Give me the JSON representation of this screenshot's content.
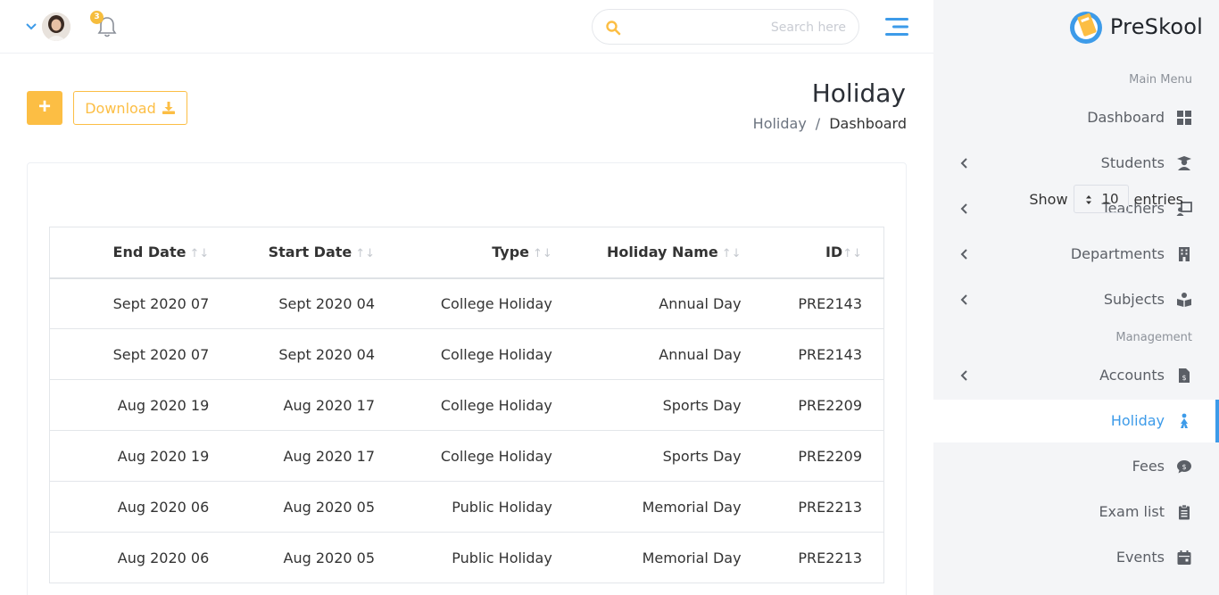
{
  "topbar": {
    "notification_count": "3",
    "search_placeholder": "Search here"
  },
  "brand": {
    "name": "PreSkool"
  },
  "sidebar": {
    "sections": {
      "main": "Main Menu",
      "management": "Management"
    },
    "items": [
      {
        "label": "Dashboard",
        "icon": "dashboard-icon",
        "has_submenu": false
      },
      {
        "label": "Students",
        "icon": "graduate-icon",
        "has_submenu": true
      },
      {
        "label": "Teachers",
        "icon": "chalkboard-teacher-icon",
        "has_submenu": true
      },
      {
        "label": "Departments",
        "icon": "building-icon",
        "has_submenu": true
      },
      {
        "label": "Subjects",
        "icon": "book-reader-icon",
        "has_submenu": true
      },
      {
        "label": "Accounts",
        "icon": "invoice-icon",
        "has_submenu": true
      },
      {
        "label": "Holiday",
        "icon": "holiday-icon",
        "has_submenu": false,
        "active": true
      },
      {
        "label": "Fees",
        "icon": "comment-dollar-icon",
        "has_submenu": false
      },
      {
        "label": "Exam list",
        "icon": "clipboard-list-icon",
        "has_submenu": false
      },
      {
        "label": "Events",
        "icon": "calendar-icon",
        "has_submenu": false
      }
    ]
  },
  "page": {
    "title": "Holiday",
    "breadcrumb": {
      "current_link": "Holiday",
      "separator": "/",
      "parent": "Dashboard"
    },
    "add_label": "+",
    "download_label": "Download"
  },
  "table_controls": {
    "show_label": "Show",
    "entries_value": "10",
    "entries_label": "entries"
  },
  "table": {
    "columns": [
      "End Date",
      "Start Date",
      "Type",
      "Holiday Name",
      "ID"
    ],
    "rows": [
      [
        "Sept 2020 07",
        "Sept 2020 04",
        "College Holiday",
        "Annual Day",
        "PRE2143"
      ],
      [
        "Sept 2020 07",
        "Sept 2020 04",
        "College Holiday",
        "Annual Day",
        "PRE2143"
      ],
      [
        "Aug 2020 19",
        "Aug 2020 17",
        "College Holiday",
        "Sports Day",
        "PRE2209"
      ],
      [
        "Aug 2020 19",
        "Aug 2020 17",
        "College Holiday",
        "Sports Day",
        "PRE2209"
      ],
      [
        "Aug 2020 06",
        "Aug 2020 05",
        "Public Holiday",
        "Memorial Day",
        "PRE2213"
      ],
      [
        "Aug 2020 06",
        "Aug 2020 05",
        "Public Holiday",
        "Memorial Day",
        "PRE2213"
      ]
    ]
  },
  "colors": {
    "accent_yellow": "#fcbe44",
    "accent_blue": "#3d9be9",
    "sidebar_bg": "#f4f5f7"
  }
}
